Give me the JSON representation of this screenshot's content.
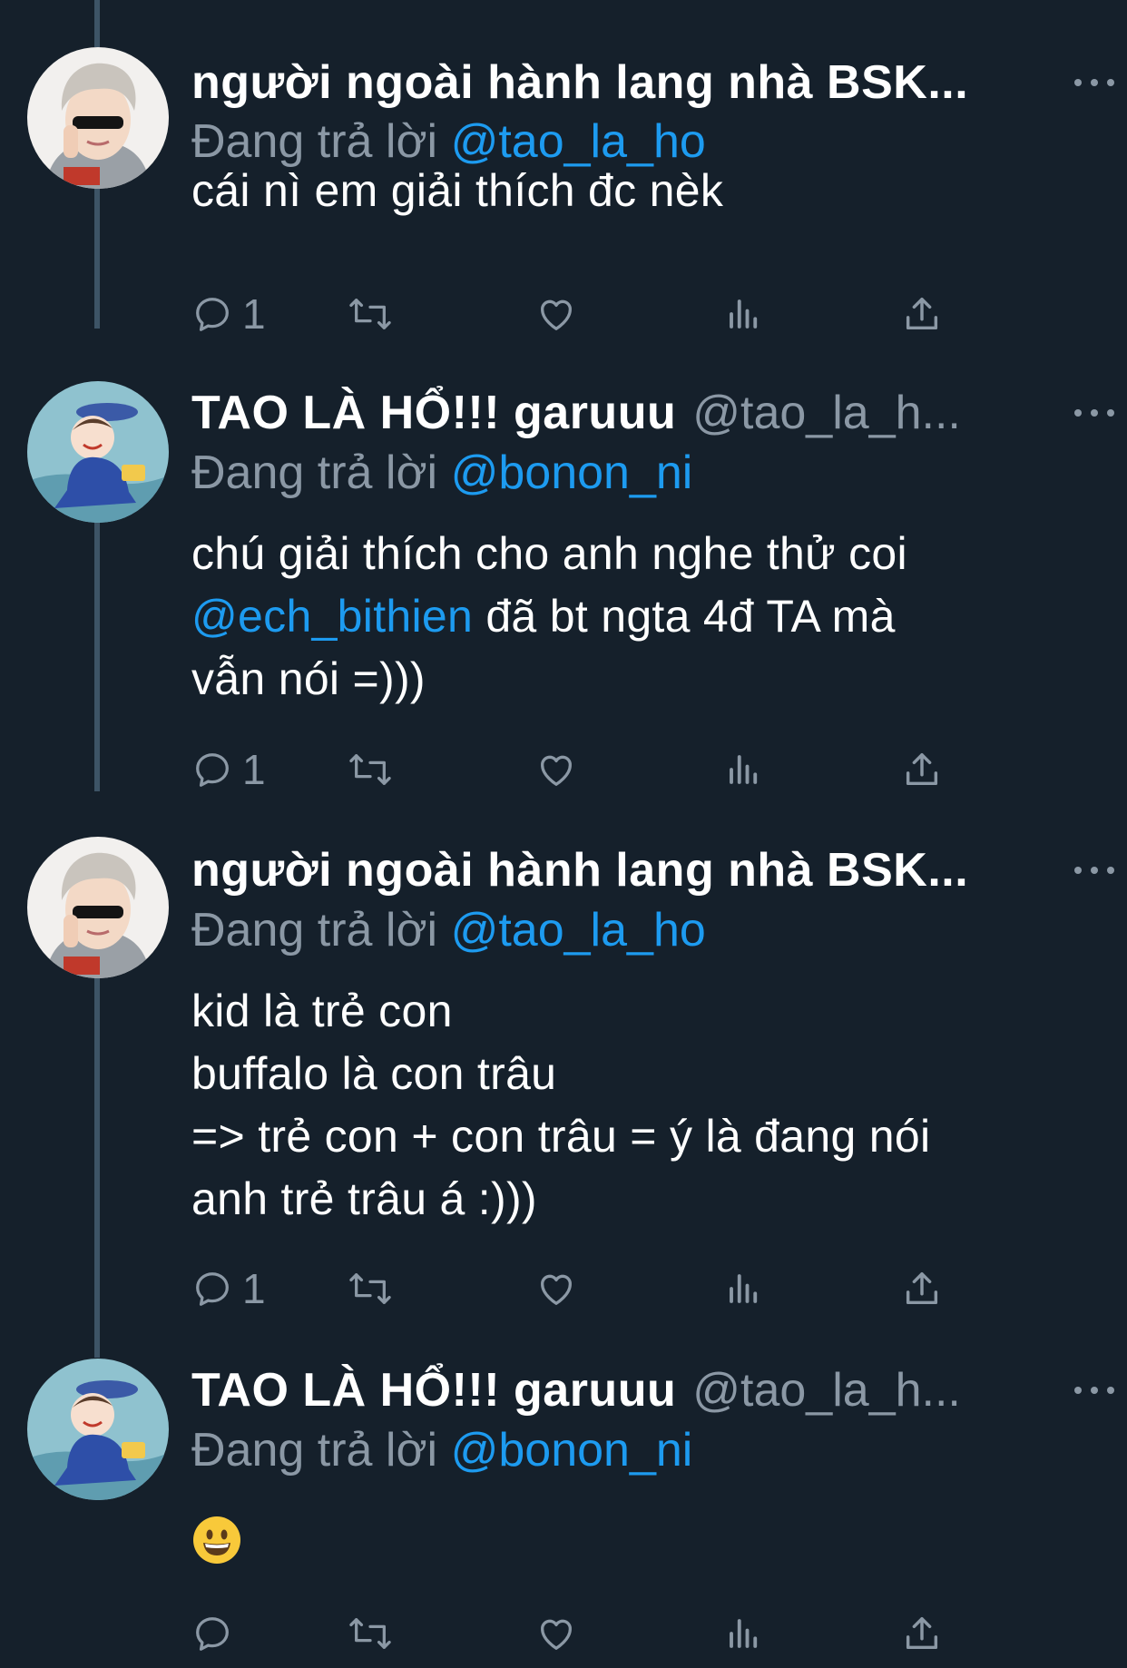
{
  "thread": {
    "tweets": [
      {
        "name": "người ngoài hành lang nhà BSK...",
        "handle": "",
        "reply_prefix": "Đang trả lời",
        "reply_to": "@tao_la_ho",
        "body_lines": [
          [
            {
              "text": "cái nì em giải thích đc nèk",
              "type": "text"
            }
          ]
        ],
        "reply_count": "1",
        "avatar": "avatar-silver-hair"
      },
      {
        "name": "TAO LÀ HỔ!!! garuuu",
        "handle": "@tao_la_h...",
        "reply_prefix": "Đang trả lời",
        "reply_to": "@bonon_ni",
        "body_lines": [
          [
            {
              "text": "chú giải thích cho anh nghe thử coi",
              "type": "text"
            }
          ],
          [
            {
              "text": "@ech_bithien",
              "type": "mention"
            },
            {
              "text": " đã bt ngta 4đ TA mà",
              "type": "text"
            }
          ],
          [
            {
              "text": "vẫn nói =)))",
              "type": "text"
            }
          ]
        ],
        "reply_count": "1",
        "avatar": "avatar-cartoon-blue"
      },
      {
        "name": "người ngoài hành lang nhà BSK...",
        "handle": "",
        "reply_prefix": "Đang trả lời",
        "reply_to": "@tao_la_ho",
        "body_lines": [
          [
            {
              "text": "kid là trẻ con",
              "type": "text"
            }
          ],
          [
            {
              "text": "buffalo là con trâu",
              "type": "text"
            }
          ],
          [
            {
              "text": "=> trẻ con + con trâu = ý là đang nói",
              "type": "text"
            }
          ],
          [
            {
              "text": "anh trẻ trâu á :)))",
              "type": "text"
            }
          ]
        ],
        "reply_count": "1",
        "avatar": "avatar-silver-hair"
      },
      {
        "name": "TAO LÀ HỔ!!! garuuu",
        "handle": "@tao_la_h...",
        "reply_prefix": "Đang trả lời",
        "reply_to": "@bonon_ni",
        "body_lines": [],
        "emoji": "grinning-face-emoji",
        "reply_count": "",
        "avatar": "avatar-cartoon-blue"
      }
    ]
  },
  "icons": {
    "reply": "reply-icon",
    "retweet": "retweet-icon",
    "like": "like-icon",
    "views": "views-icon",
    "share": "share-icon",
    "more": "more-icon"
  },
  "colors": {
    "background": "#15202b",
    "text": "#ffffff",
    "secondary": "#8b98a5",
    "accent": "#1d9bf0",
    "thread_line": "#3d5466"
  }
}
